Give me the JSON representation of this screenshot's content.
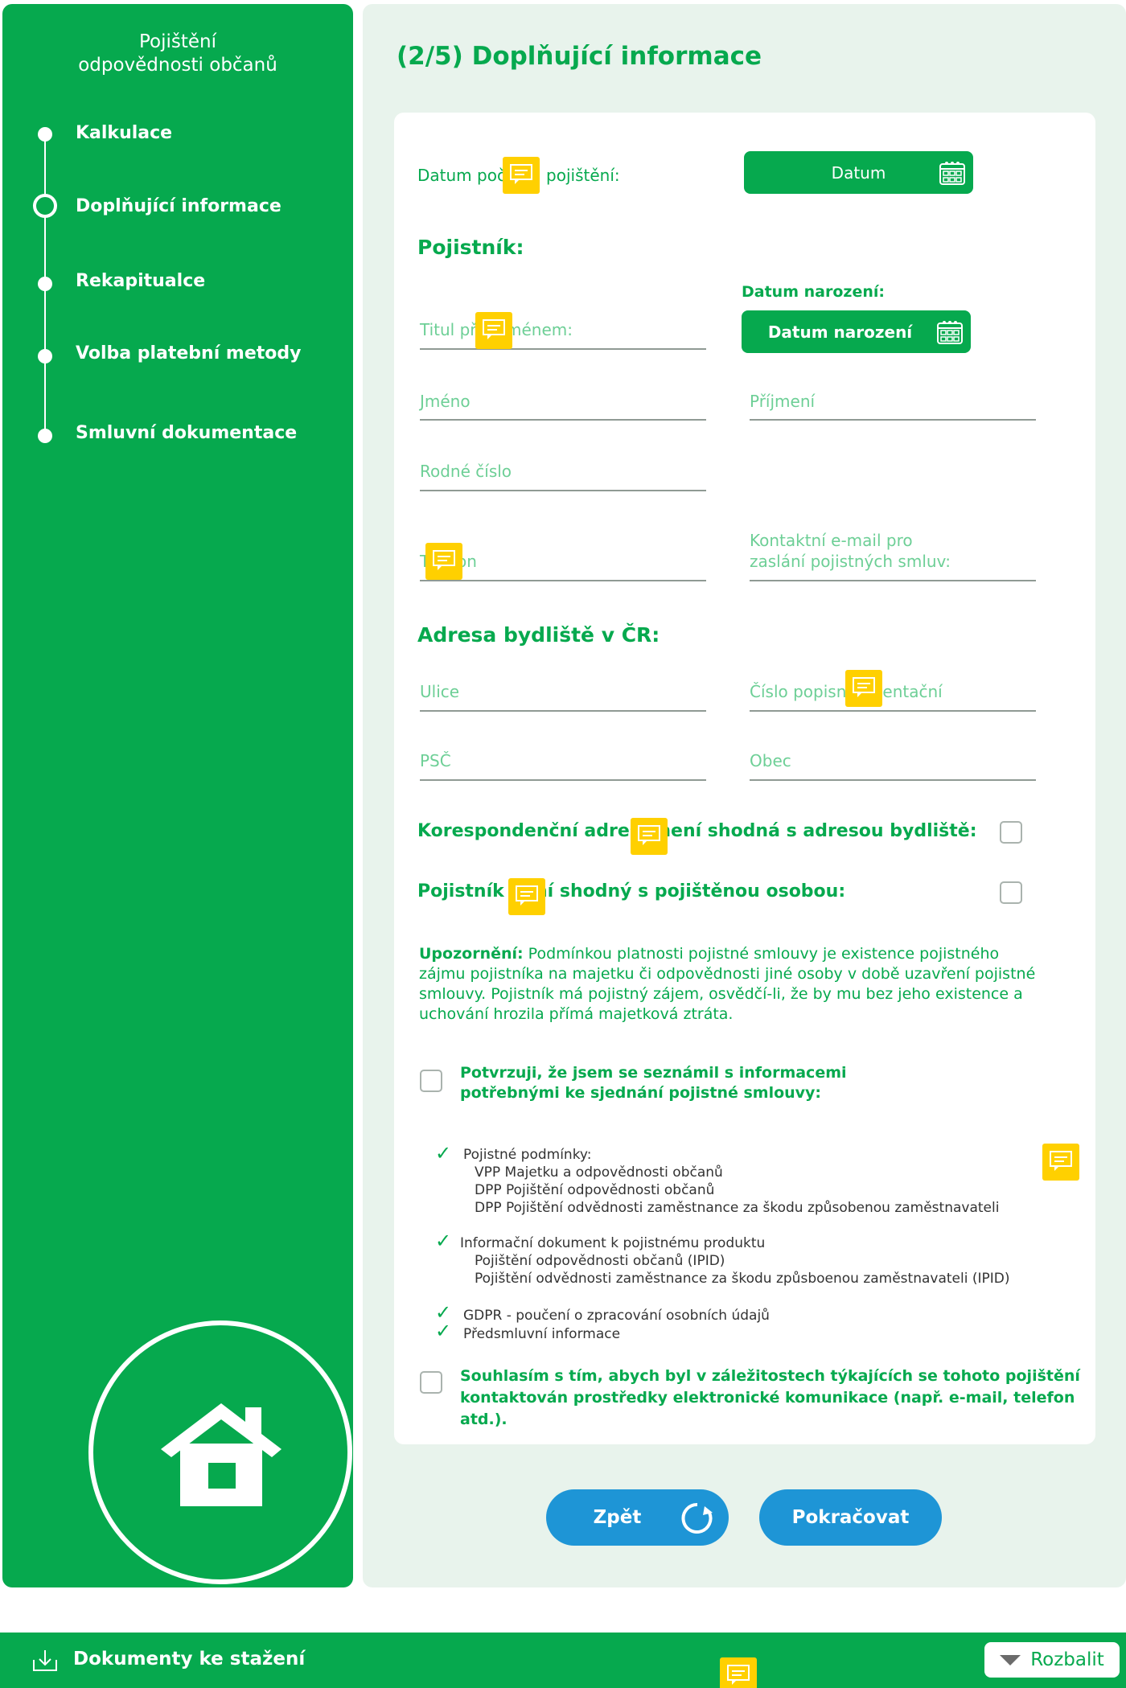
{
  "sidebar": {
    "title_line1": "Pojištění",
    "title_line2": "odpovědnosti občanů",
    "steps": [
      {
        "label": "Kalkulace",
        "current": false
      },
      {
        "label": "Doplňující informace",
        "current": true
      },
      {
        "label": "Rekapitualce",
        "current": false
      },
      {
        "label": "Volba platební metody",
        "current": false
      },
      {
        "label": "Smluvní dokumentace",
        "current": false
      }
    ]
  },
  "main": {
    "title": "(2/5) Doplňující informace",
    "start_date_label": "Datum počátku pojištění:",
    "date_button": "Datum",
    "policyholder_heading": "Pojistník:",
    "birthdate_label": "Datum narození:",
    "birthdate_button": "Datum narození",
    "fields": {
      "title_before_name": "Titul před jménem:",
      "first_name": "Jméno",
      "last_name": "Příjmení",
      "birth_number": "Rodné číslo",
      "phone": "Telefon",
      "email_line1": "Kontaktní e-mail pro",
      "email_line2": "zaslání pojistných smluv:"
    },
    "address_heading": "Adresa bydliště v ČR:",
    "address_fields": {
      "street": "Ulice",
      "house_number": "Číslo popisné/orientační",
      "zip": "PSČ",
      "city": "Obec"
    },
    "corr_address_label": "Korespondenční adresa není shodná s adresou bydliště:",
    "holder_not_insured_label": "Pojistník není shodný s pojištěnou osobou:",
    "notice_bold": "Upozornění:",
    "notice_text": "Podmínkou platnosti pojistné smlouvy je existence pojistného zájmu pojistníka na majetku či odpovědnosti jiné osoby v době uzavření pojistné smlouvy. Pojistník má pojistný zájem, osvědčí-li, že by mu bez jeho existence a uchování hrozila přímá majetková ztráta.",
    "confirm_line1": "Potvrzuji, že jsem se seznámil s informacemi",
    "confirm_line2": "potřebnými ke sjednání pojistné smlouvy:",
    "docs": {
      "conditions_title": "Pojistné podmínky:",
      "conditions": [
        "VPP Majetku a odpovědnosti občanů",
        "DPP Pojištění odpovědnosti občanů",
        "DPP Pojištění odvědnosti zaměstnance za škodu způsobenou zaměstnavateli"
      ],
      "info_title": "Informační dokument k pojistnému produktu",
      "info_items": [
        "Pojištění odpovědnosti občanů (IPID)",
        "Pojištění odvědnosti zaměstnance za škodu způsboenou zaměstnavateli (IPID)"
      ],
      "gdpr": "GDPR - poučení o zpracování osobních údajů",
      "precontract": "Předsmluvní informace"
    },
    "consent_line1": "Souhlasím s tím, abych byl v záležitostech týkajících se tohoto pojištění",
    "consent_line2": "kontaktován prostředky elektronické komunikace (např. e-mail, telefon atd.).",
    "back_button": "Zpět",
    "continue_button": "Pokračovat"
  },
  "bottom_bar": {
    "label": "Dokumenty ke stažení",
    "expand_button": "Rozbalit"
  },
  "colors": {
    "brand_green": "#06a94e",
    "panel_bg": "#e8f3ec",
    "button_blue": "#1e95d6",
    "comment_yellow": "#ffd000"
  },
  "icons": [
    "calendar-icon",
    "house-icon",
    "refresh-icon",
    "download-icon",
    "comment-icon",
    "check-icon",
    "triangle-down-icon"
  ]
}
